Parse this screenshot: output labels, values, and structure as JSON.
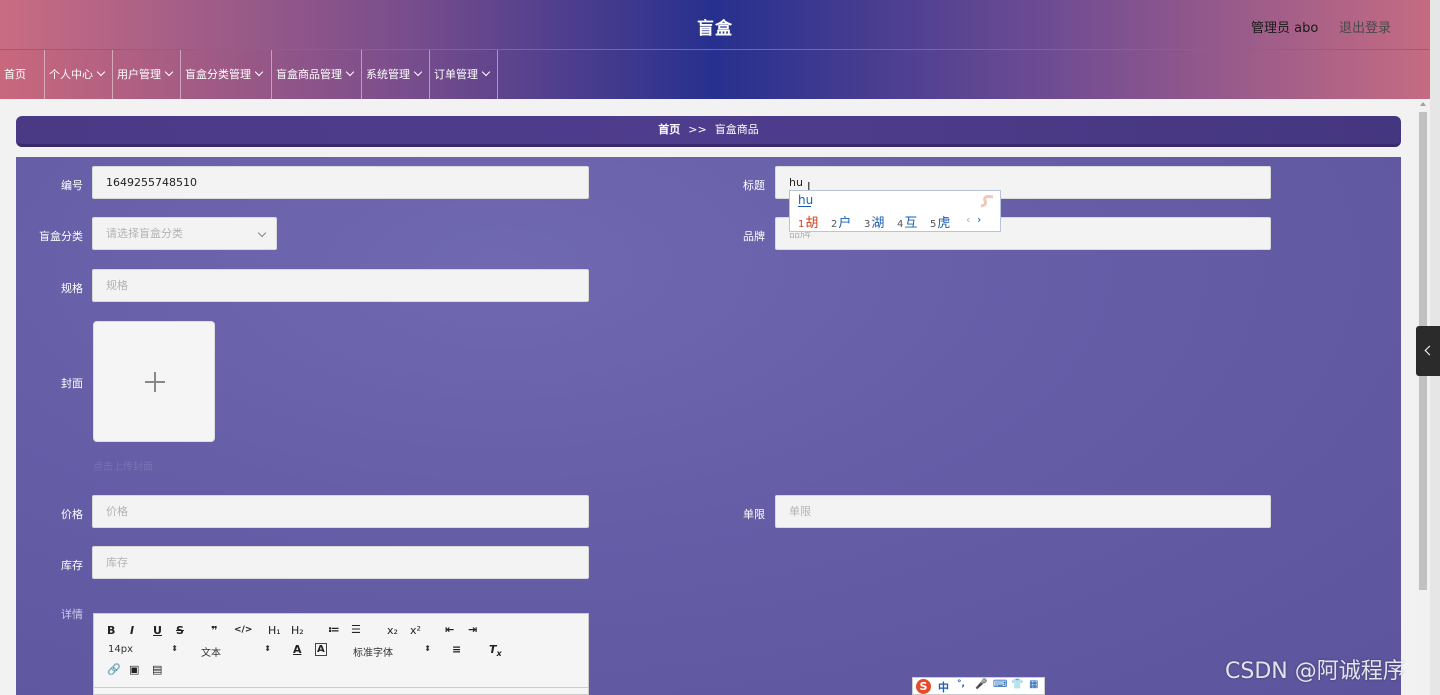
{
  "header": {
    "title": "盲盒",
    "user": "管理员 abo",
    "logout": "退出登录"
  },
  "nav": [
    {
      "label": "首页",
      "dropdown": false
    },
    {
      "label": "个人中心",
      "dropdown": true
    },
    {
      "label": "用户管理",
      "dropdown": true
    },
    {
      "label": "盲盒分类管理",
      "dropdown": true
    },
    {
      "label": "盲盒商品管理",
      "dropdown": true
    },
    {
      "label": "系统管理",
      "dropdown": true
    },
    {
      "label": "订单管理",
      "dropdown": true
    }
  ],
  "breadcrumb": {
    "home": "首页",
    "sep": ">>",
    "current": "盲盒商品"
  },
  "form": {
    "code": {
      "label": "编号",
      "value": "1649255748510"
    },
    "title": {
      "label": "标题",
      "value": "hu"
    },
    "category": {
      "label": "盲盒分类",
      "placeholder": "请选择盲盒分类"
    },
    "brand": {
      "label": "品牌",
      "placeholder": "品牌"
    },
    "spec": {
      "label": "规格",
      "placeholder": "规格"
    },
    "cover": {
      "label": "封面",
      "tip": "点击上传封面"
    },
    "price": {
      "label": "价格",
      "placeholder": "价格"
    },
    "limit": {
      "label": "单限",
      "placeholder": "单限"
    },
    "stock": {
      "label": "库存",
      "placeholder": "库存"
    },
    "detail": {
      "label": "详情"
    }
  },
  "editor": {
    "font_size": "14px",
    "block_type": "文本",
    "font_family": "标准字体",
    "toolbar_row1": [
      "B",
      "I",
      "U",
      "S",
      "❞",
      "</>",
      "H₁",
      "H₂",
      "≔",
      "☰",
      "x₂",
      "x²",
      "⇤",
      "⇥"
    ]
  },
  "ime": {
    "composition": "hu",
    "candidates": [
      {
        "n": "1",
        "text": "胡"
      },
      {
        "n": "2",
        "text": "户"
      },
      {
        "n": "3",
        "text": "湖"
      },
      {
        "n": "4",
        "text": "互"
      },
      {
        "n": "5",
        "text": "虎"
      }
    ],
    "bar": [
      "S",
      "中",
      "°,",
      "🎤",
      "⌨",
      "👕",
      "▦"
    ]
  },
  "watermark": "CSDN @阿诚程序"
}
